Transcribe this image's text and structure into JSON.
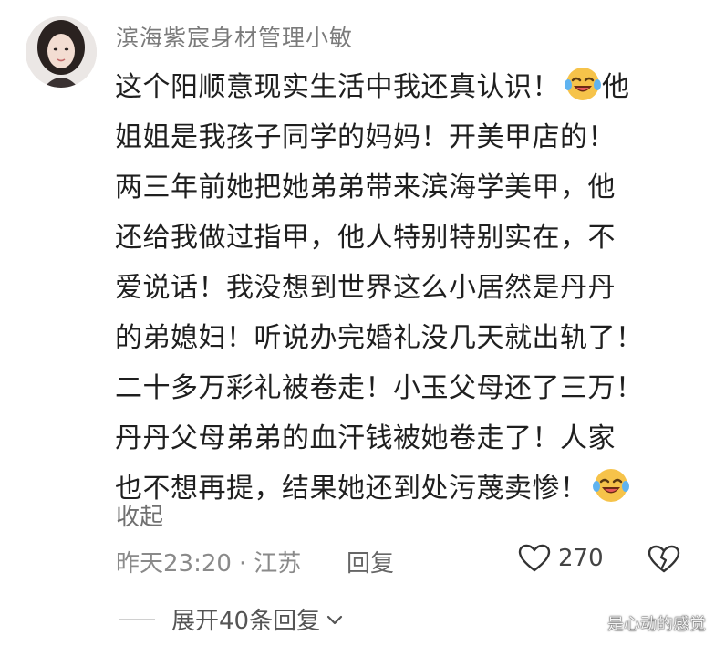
{
  "comment": {
    "username": "滨海紫宸身材管理小敏",
    "lines": [
      "这个阳顺意现实生活中我还真认识！",
      "姐姐是我孩子同学的妈妈！开美甲店的！",
      "两三年前她把她弟弟带来滨海学美甲，他",
      "还给我做过指甲，他人特别特别实在，不",
      "爱说话！我没想到世界这么小居然是丹丹",
      "的弟媳妇！听说办完婚礼没几天就出轨了！",
      "二十多万彩礼被卷走！小玉父母还了三万！",
      "丹丹父母弟弟的血汗钱被她卷走了！人家",
      "也不想再提，结果她还到处污蔑卖惨！"
    ],
    "line1_tail": "他",
    "emoji_names": [
      "laughing-crying-emoji",
      "laughing-crying-emoji"
    ],
    "collapse_label": "收起",
    "time": "昨天23:20",
    "dot": "·",
    "location": "江苏",
    "reply_label": "回复",
    "like_count": "270",
    "expand_label": "展开40条回复"
  },
  "watermark": "是心动的感觉",
  "colors": {
    "text": "#1f1f1f",
    "muted": "#8a8a8a",
    "emoji_face": "#f6c34a"
  }
}
